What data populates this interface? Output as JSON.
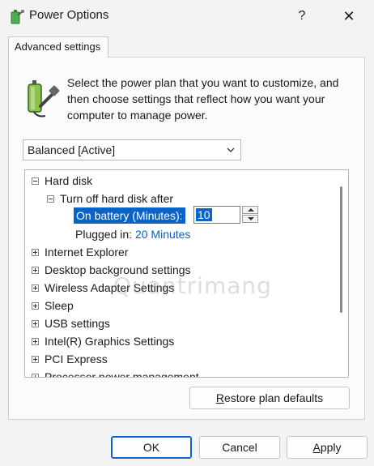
{
  "window": {
    "title": "Power Options",
    "help_glyph": "?",
    "close_glyph": "✕"
  },
  "tab": {
    "label": "Advanced settings"
  },
  "description": "Select the power plan that you want to customize, and then choose settings that reflect how you want your computer to manage power.",
  "plan_select": {
    "value": "Balanced [Active]"
  },
  "tree": {
    "hard_disk": "Hard disk",
    "turn_off": "Turn off hard disk after",
    "on_battery_label": "On battery (Minutes):",
    "on_battery_value": "10",
    "plugged_in_label": "Plugged in:",
    "plugged_in_value": "20 Minutes",
    "items": [
      "Internet Explorer",
      "Desktop background settings",
      "Wireless Adapter Settings",
      "Sleep",
      "USB settings",
      "Intel(R) Graphics Settings",
      "PCI Express",
      "Processor power management"
    ]
  },
  "watermark": "Quantrimang",
  "buttons": {
    "restore_first": "R",
    "restore_rest": "estore plan defaults",
    "ok": "OK",
    "cancel": "Cancel",
    "apply_first": "A",
    "apply_rest": "pply"
  },
  "colors": {
    "accent": "#0a64c8",
    "link": "#0a5fbf",
    "background": "#f3f3f3"
  },
  "icons": [
    "power-options-icon",
    "help-icon",
    "close-icon",
    "battery-plug-icon",
    "chevron-down-icon",
    "collapse-icon",
    "expand-icon",
    "spin-up-icon",
    "spin-down-icon"
  ]
}
